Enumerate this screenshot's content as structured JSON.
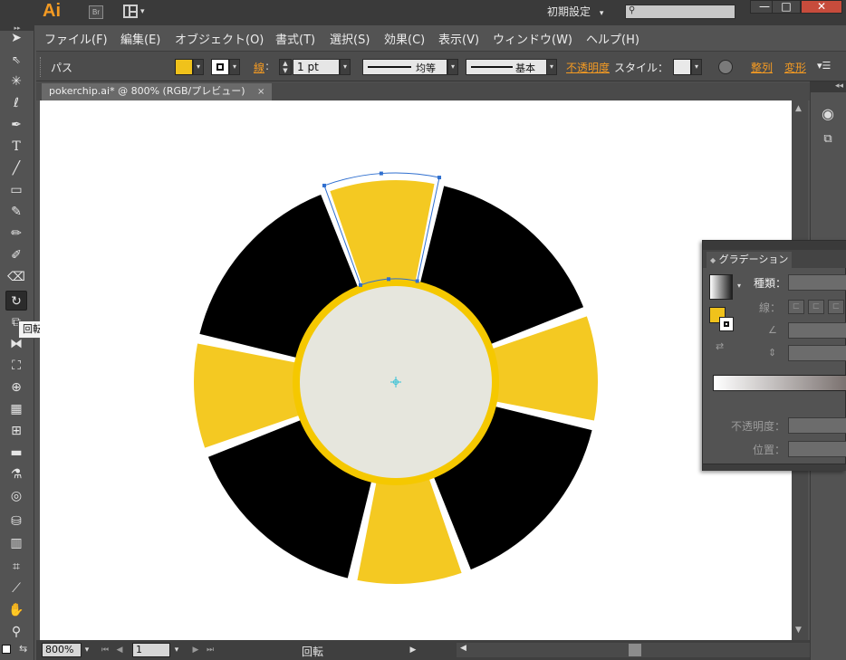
{
  "titlebar": {
    "app_logo": "Ai",
    "bridge_label": "Br",
    "workspace": "初期設定",
    "workspace_arrow": "▾",
    "search_placeholder": "",
    "minimize": "—",
    "maximize": "□",
    "close": "✕"
  },
  "menu": [
    "ファイル(F)",
    "編集(E)",
    "オブジェクト(O)",
    "書式(T)",
    "選択(S)",
    "効果(C)",
    "表示(V)",
    "ウィンドウ(W)",
    "ヘルプ(H)"
  ],
  "control": {
    "selection_type": "パス",
    "fill_color": "#f0c21b",
    "stroke_color": "#ffffff",
    "stroke_label": "線",
    "stroke_weight": "1 pt",
    "profile_label": "均等",
    "brush_label": "基本",
    "opacity_label": "不透明度",
    "style_label": "スタイル：",
    "align_label": "整列",
    "transform_label": "変形"
  },
  "document": {
    "tab_title": "pokerchip.ai* @ 800% (RGB/プレビュー)",
    "tab_close": "×"
  },
  "tooltip": "回転ツール (R)",
  "chip": {
    "outer_color": "#000000",
    "segment_color": "#f4c922",
    "ring_color": "#f5c800",
    "center_color": "#e6e6dd",
    "selection_color": "#2f6fcf",
    "center_mark_color": "#34c1d6"
  },
  "statusbar": {
    "zoom": "800%",
    "artboard": "1",
    "tool_status": "回転"
  },
  "gradient_panel": {
    "title": "グラデーション",
    "type_label": "種類：",
    "stroke_label": "線：",
    "opacity_label": "不透明度：",
    "position_label": "位置：",
    "swatch_color": "#f0c21b"
  }
}
